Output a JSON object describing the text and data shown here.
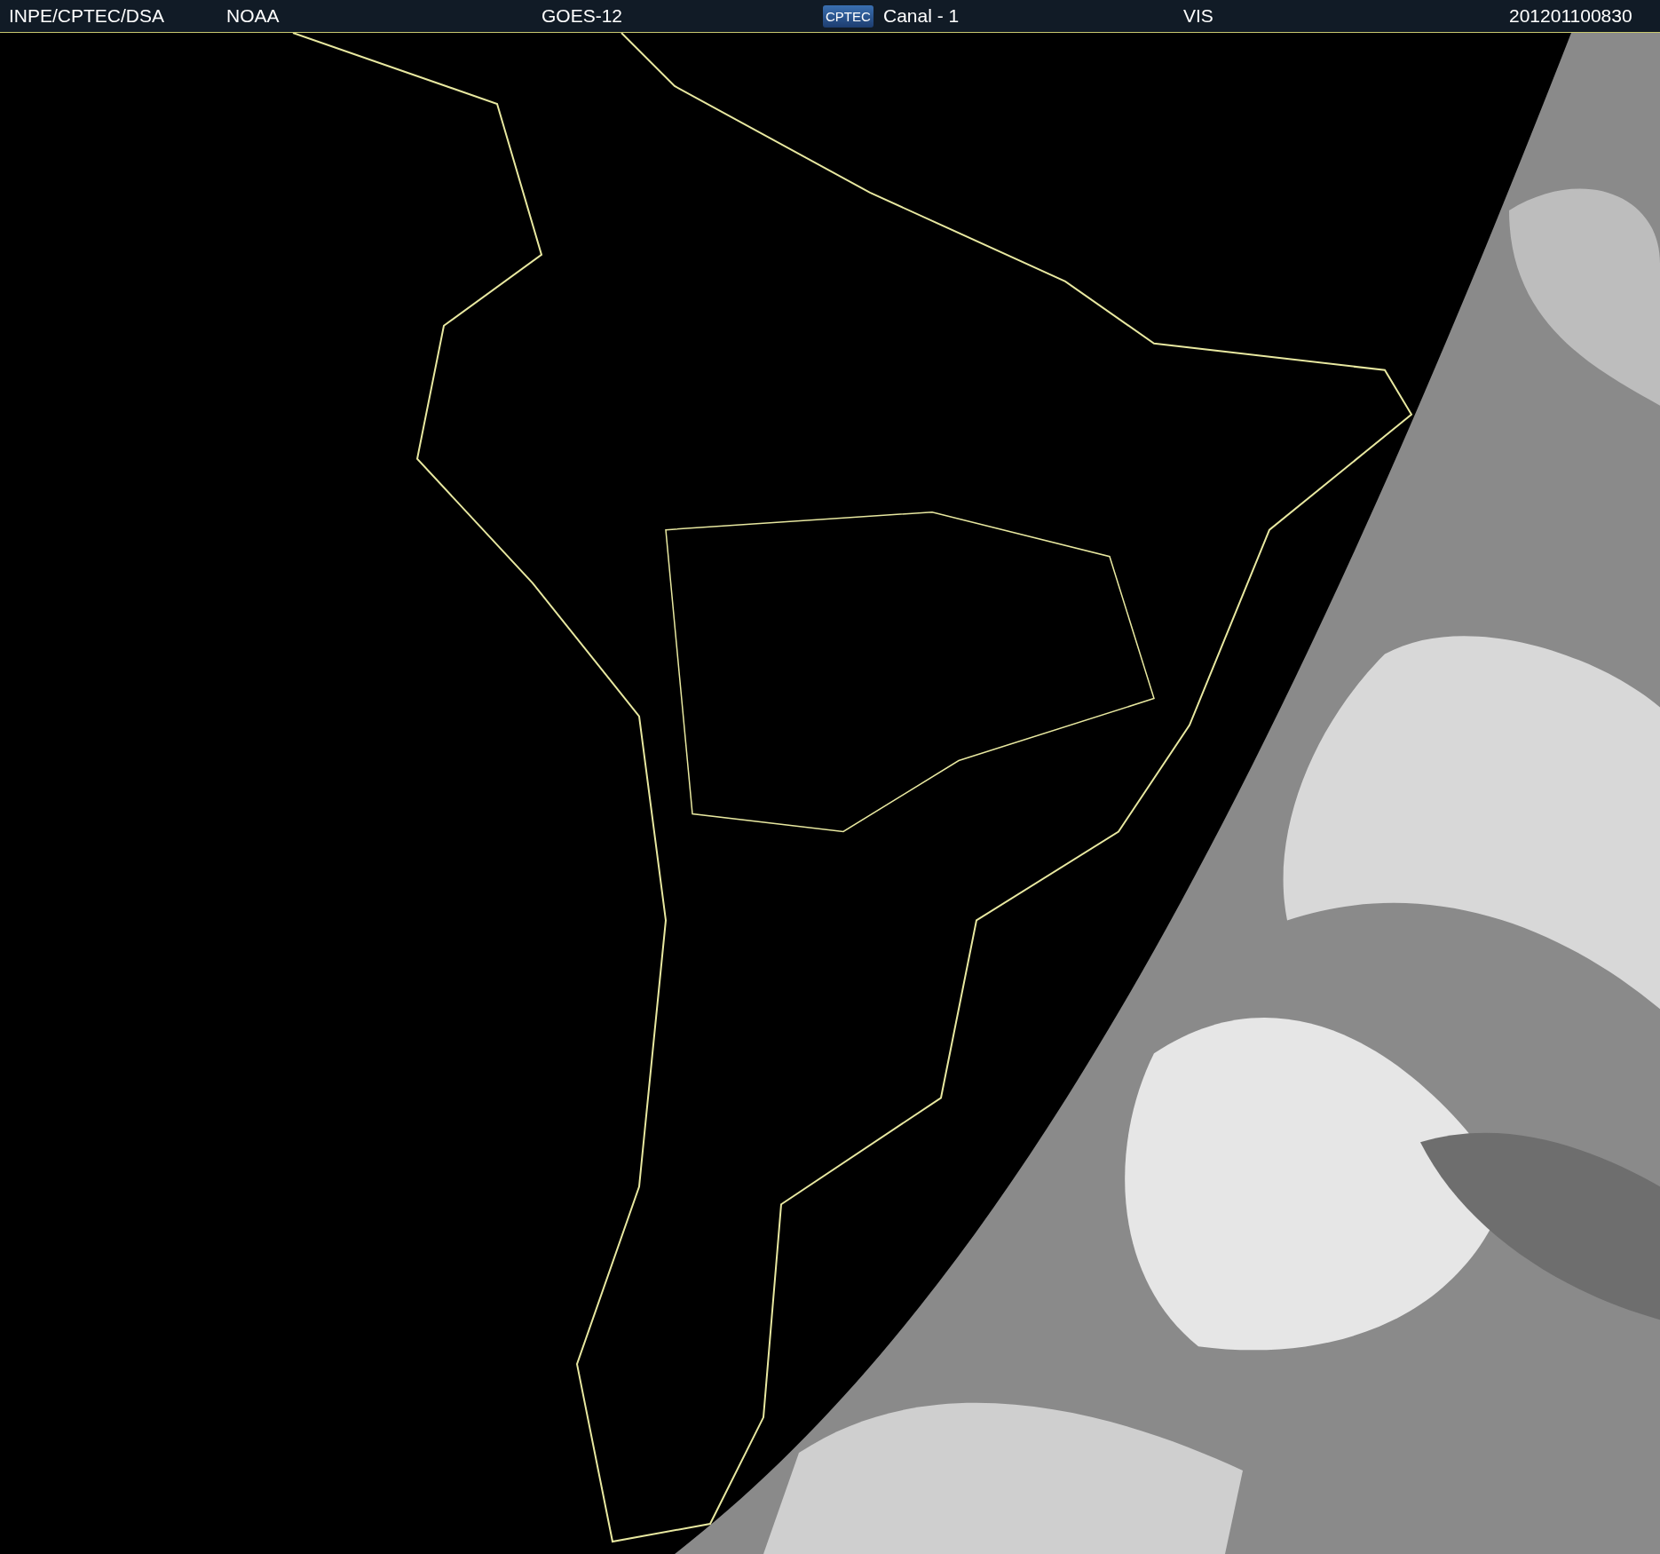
{
  "header": {
    "source": "INPE/CPTEC/DSA",
    "agency": "NOAA",
    "satellite": "GOES-12",
    "logo": "CPTEC",
    "channel": "Canal - 1",
    "band": "VIS",
    "timestamp": "201201100830"
  }
}
